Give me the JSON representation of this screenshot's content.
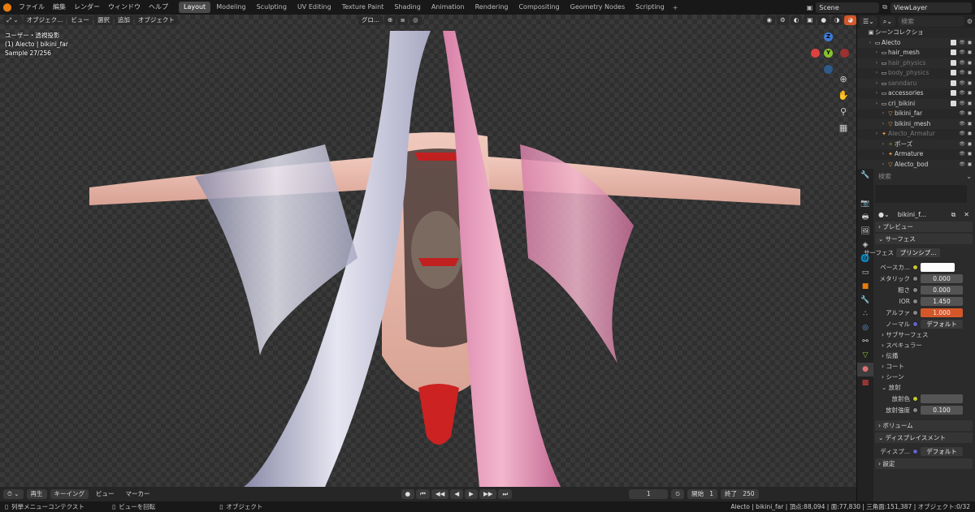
{
  "menu": [
    "ファイル",
    "編集",
    "レンダー",
    "ウィンドウ",
    "ヘルプ"
  ],
  "workspaces": [
    {
      "label": "Layout",
      "active": true
    },
    {
      "label": "Modeling"
    },
    {
      "label": "Sculpting"
    },
    {
      "label": "UV Editing"
    },
    {
      "label": "Texture Paint"
    },
    {
      "label": "Shading"
    },
    {
      "label": "Animation"
    },
    {
      "label": "Rendering"
    },
    {
      "label": "Compositing"
    },
    {
      "label": "Geometry Nodes"
    },
    {
      "label": "Scripting"
    }
  ],
  "scene": "Scene",
  "view_layer": "ViewLayer",
  "viewport": {
    "mode": "オブジェク...",
    "menus": [
      "ビュー",
      "選択",
      "追加",
      "オブジェクト"
    ],
    "orientation": "グロ...",
    "info_lines": [
      "ユーザー・透視投影",
      "(1) Alecto | bikini_far",
      "Sample 27/256"
    ],
    "gizmo": {
      "z": "Z",
      "y": "Y"
    }
  },
  "outliner": {
    "search_placeholder": "検索",
    "rows": [
      {
        "label": "シーンコレクション",
        "depth": 0,
        "icon": "scene",
        "dim": false
      },
      {
        "label": "Alecto",
        "depth": 1,
        "icon": "collection",
        "dim": false
      },
      {
        "label": "hair_mesh",
        "depth": 2,
        "icon": "collection",
        "dim": false
      },
      {
        "label": "hair_physics",
        "depth": 2,
        "icon": "collection",
        "dim": true
      },
      {
        "label": "body_physics",
        "depth": 2,
        "icon": "collection",
        "dim": true
      },
      {
        "label": "sanndaru",
        "depth": 2,
        "icon": "collection",
        "dim": true
      },
      {
        "label": "accessories",
        "depth": 2,
        "icon": "collection",
        "dim": false
      },
      {
        "label": "cri_bikini",
        "depth": 2,
        "icon": "collection",
        "dim": false
      },
      {
        "label": "bikini_far",
        "depth": 3,
        "icon": "mesh",
        "dim": false
      },
      {
        "label": "bikini_mesh",
        "depth": 3,
        "icon": "mesh",
        "dim": false
      },
      {
        "label": "Alecto_Armatur",
        "depth": 2,
        "icon": "armature",
        "dim": true
      },
      {
        "label": "ポーズ",
        "depth": 3,
        "icon": "pose",
        "dim": false
      },
      {
        "label": "Armature",
        "depth": 3,
        "icon": "armature",
        "dim": false
      },
      {
        "label": "Alecto_bod",
        "depth": 3,
        "icon": "mesh",
        "dim": false
      }
    ]
  },
  "properties": {
    "search_placeholder": "検索",
    "material_name": "bikini_f...",
    "sections": {
      "preview": "プレビュー",
      "surface": "サーフェス",
      "volume": "ボリューム",
      "displacement": "ディスプレイスメント",
      "settings": "設定"
    },
    "surface_label": "サーフェス",
    "surface_value": "プリンシプ...",
    "base_color_label": "ベースカ...",
    "params": [
      {
        "label": "メタリック",
        "value": "0.000"
      },
      {
        "label": "粗さ",
        "value": "0.000"
      },
      {
        "label": "IOR",
        "value": "1.450"
      }
    ],
    "alpha_label": "アルファ",
    "alpha_value": "1.000",
    "normal_label": "ノーマル",
    "normal_value": "デフォルト",
    "subpanels": [
      "サブサーフェス",
      "スペキュラー",
      "伝播",
      "コート",
      "シーン"
    ],
    "emission_label": "放射",
    "emission_color_label": "放射色",
    "emission_strength_label": "放射強度",
    "emission_strength_value": "0.100",
    "displacement_label": "ディスプ...",
    "displacement_value": "デフォルト"
  },
  "timeline": {
    "playback": "再生",
    "keying": "キーイング",
    "view": "ビュー",
    "marker": "マーカー",
    "current_frame": "1",
    "start_label": "開始",
    "start": "1",
    "end_label": "終了",
    "end": "250"
  },
  "status": {
    "left1": "列挙メニューコンテクスト",
    "left2": "ビューを回転",
    "left3": "オブジェクト",
    "right": "Alecto | bikini_far | 頂点:88,094 | 面:77,830 | 三角面:151,387 | オブジェクト:0/32"
  },
  "colors": {
    "accent": "#e87d0d",
    "active_tab": "#4a4a4a",
    "alpha_field": "#d4572a",
    "gizmo_x": "#e04040",
    "gizmo_y": "#8ac22c",
    "gizmo_z": "#3d7ad6"
  }
}
